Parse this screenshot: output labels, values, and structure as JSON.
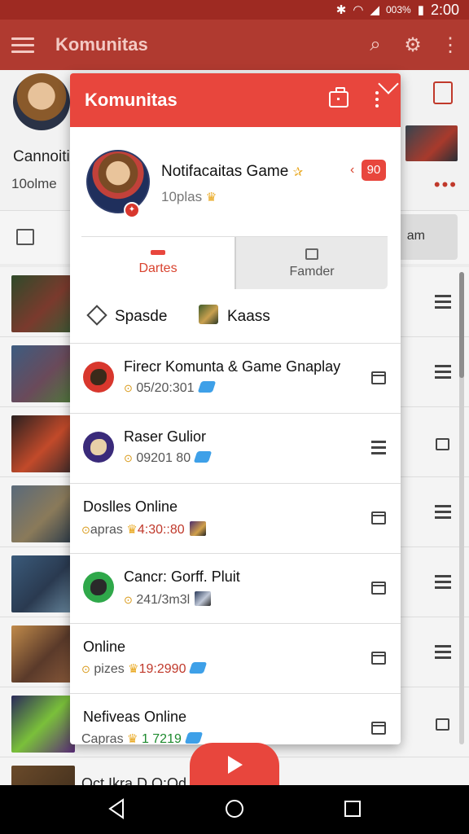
{
  "status_bar": {
    "battery": "003%",
    "time": "2:00"
  },
  "app_bar": {
    "title": "Komunitas"
  },
  "background": {
    "profile_name": "Cannoiti",
    "profile_sub": "10olme",
    "tab_right_label": "am",
    "bottom_text": "Oct Ikra D O:Od"
  },
  "card": {
    "title": "Komunitas",
    "profile": {
      "name": "Notifacaitas Game",
      "sub": "10plas",
      "badge": "90"
    },
    "tabs": [
      {
        "label": "Dartes"
      },
      {
        "label": "Famder"
      }
    ],
    "filters": [
      {
        "label": "Spasde"
      },
      {
        "label": "Kaass"
      }
    ],
    "items": [
      {
        "title": "Firecr Komunta & Game Gnaplay",
        "prefix": "",
        "value": "05/20:301"
      },
      {
        "title": "Raser Gulior",
        "prefix": "",
        "value": "09201 80"
      },
      {
        "title": "Doslles Online",
        "prefix": "apras",
        "value": "4:30::80"
      },
      {
        "title": "Cancr: Gorff. Pluit",
        "prefix": "",
        "value": "241/3m3l"
      },
      {
        "title": "Online",
        "prefix": "pizes",
        "value": "19:2990"
      },
      {
        "title": "Nefiveas Online",
        "prefix": "Capras",
        "value": "1 7219"
      }
    ]
  },
  "colors": {
    "accent": "#e8463d",
    "app_bar": "#b03a30",
    "status_bar": "#9e2a22"
  }
}
